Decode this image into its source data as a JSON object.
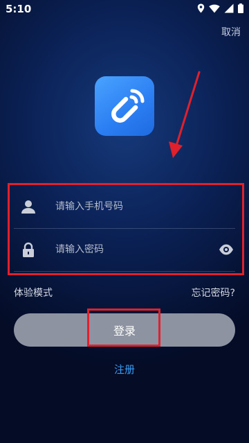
{
  "status_bar": {
    "time": "5:10",
    "icons": [
      "location-icon",
      "wifi-icon",
      "signal-icon",
      "battery-icon"
    ]
  },
  "header": {
    "cancel_label": "取消"
  },
  "app": {
    "logo_icon": "nfc-tap-icon",
    "logo_color": "#2b7ef2"
  },
  "form": {
    "phone": {
      "placeholder": "请输入手机号码",
      "value": "",
      "icon": "user-icon"
    },
    "password": {
      "placeholder": "请输入密码",
      "value": "",
      "icon": "lock-icon",
      "toggle_icon": "eye-icon"
    }
  },
  "links": {
    "trial_mode": "体验模式",
    "forgot_password": "忘记密码?",
    "register": "注册"
  },
  "login_button": {
    "label": "登录",
    "color": "#8d93a0"
  },
  "annotations": {
    "highlight_color": "#e0202a"
  }
}
